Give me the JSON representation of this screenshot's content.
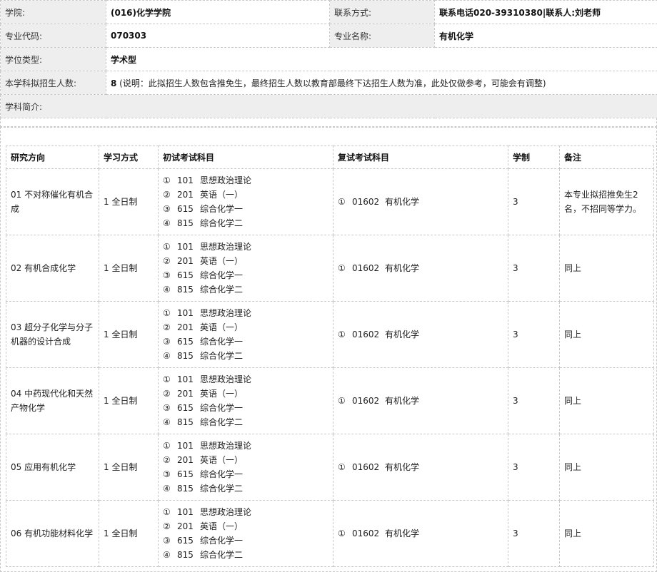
{
  "info": {
    "college_label": "学院:",
    "college_value": "(016)化学学院",
    "contact_label": "联系方式:",
    "contact_value": "联系电话020-39310380|联系人:刘老师",
    "major_code_label": "专业代码:",
    "major_code_value": "070303",
    "major_name_label": "专业名称:",
    "major_name_value": "有机化学",
    "degree_type_label": "学位类型:",
    "degree_type_value": "学术型",
    "enroll_label": "本学科拟招生人数:",
    "enroll_value": "8",
    "enroll_note": " (说明：此拟招生人数包含推免生，最终招生人数以教育部最终下达招生人数为准，此处仅做参考，可能会有调整)",
    "intro_label": "学科简介:"
  },
  "table": {
    "headers": [
      "研究方向",
      "学习方式",
      "初试考试科目",
      "复试考试科目",
      "学制",
      "备注"
    ],
    "rows": [
      {
        "direction": "01 不对称催化有机合成",
        "mode": "1 全日制",
        "exams": [
          {
            "idx": "①",
            "code": "101",
            "name": "思想政治理论"
          },
          {
            "idx": "②",
            "code": "201",
            "name": "英语（一）"
          },
          {
            "idx": "③",
            "code": "615",
            "name": "综合化学一"
          },
          {
            "idx": "④",
            "code": "815",
            "name": "综合化学二"
          }
        ],
        "retest": {
          "idx": "①",
          "code": "01602",
          "name": "有机化学"
        },
        "years": "3",
        "remark": "本专业拟招推免生2名，不招同等学力。"
      },
      {
        "direction": "02 有机合成化学",
        "mode": "1 全日制",
        "exams": [
          {
            "idx": "①",
            "code": "101",
            "name": "思想政治理论"
          },
          {
            "idx": "②",
            "code": "201",
            "name": "英语（一）"
          },
          {
            "idx": "③",
            "code": "615",
            "name": "综合化学一"
          },
          {
            "idx": "④",
            "code": "815",
            "name": "综合化学二"
          }
        ],
        "retest": {
          "idx": "①",
          "code": "01602",
          "name": "有机化学"
        },
        "years": "3",
        "remark": "同上"
      },
      {
        "direction": "03 超分子化学与分子机器的设计合成",
        "mode": "1 全日制",
        "exams": [
          {
            "idx": "①",
            "code": "101",
            "name": "思想政治理论"
          },
          {
            "idx": "②",
            "code": "201",
            "name": "英语（一）"
          },
          {
            "idx": "③",
            "code": "615",
            "name": "综合化学一"
          },
          {
            "idx": "④",
            "code": "815",
            "name": "综合化学二"
          }
        ],
        "retest": {
          "idx": "①",
          "code": "01602",
          "name": "有机化学"
        },
        "years": "3",
        "remark": "同上"
      },
      {
        "direction": "04 中药现代化和天然产物化学",
        "mode": "1 全日制",
        "exams": [
          {
            "idx": "①",
            "code": "101",
            "name": "思想政治理论"
          },
          {
            "idx": "②",
            "code": "201",
            "name": "英语（一）"
          },
          {
            "idx": "③",
            "code": "615",
            "name": "综合化学一"
          },
          {
            "idx": "④",
            "code": "815",
            "name": "综合化学二"
          }
        ],
        "retest": {
          "idx": "①",
          "code": "01602",
          "name": "有机化学"
        },
        "years": "3",
        "remark": "同上"
      },
      {
        "direction": "05 应用有机化学",
        "mode": "1 全日制",
        "exams": [
          {
            "idx": "①",
            "code": "101",
            "name": "思想政治理论"
          },
          {
            "idx": "②",
            "code": "201",
            "name": "英语（一）"
          },
          {
            "idx": "③",
            "code": "615",
            "name": "综合化学一"
          },
          {
            "idx": "④",
            "code": "815",
            "name": "综合化学二"
          }
        ],
        "retest": {
          "idx": "①",
          "code": "01602",
          "name": "有机化学"
        },
        "years": "3",
        "remark": "同上"
      },
      {
        "direction": "06 有机功能材料化学",
        "mode": "1 全日制",
        "exams": [
          {
            "idx": "①",
            "code": "101",
            "name": "思想政治理论"
          },
          {
            "idx": "②",
            "code": "201",
            "name": "英语（一）"
          },
          {
            "idx": "③",
            "code": "615",
            "name": "综合化学一"
          },
          {
            "idx": "④",
            "code": "815",
            "name": "综合化学二"
          }
        ],
        "retest": {
          "idx": "①",
          "code": "01602",
          "name": "有机化学"
        },
        "years": "3",
        "remark": "同上"
      }
    ]
  }
}
